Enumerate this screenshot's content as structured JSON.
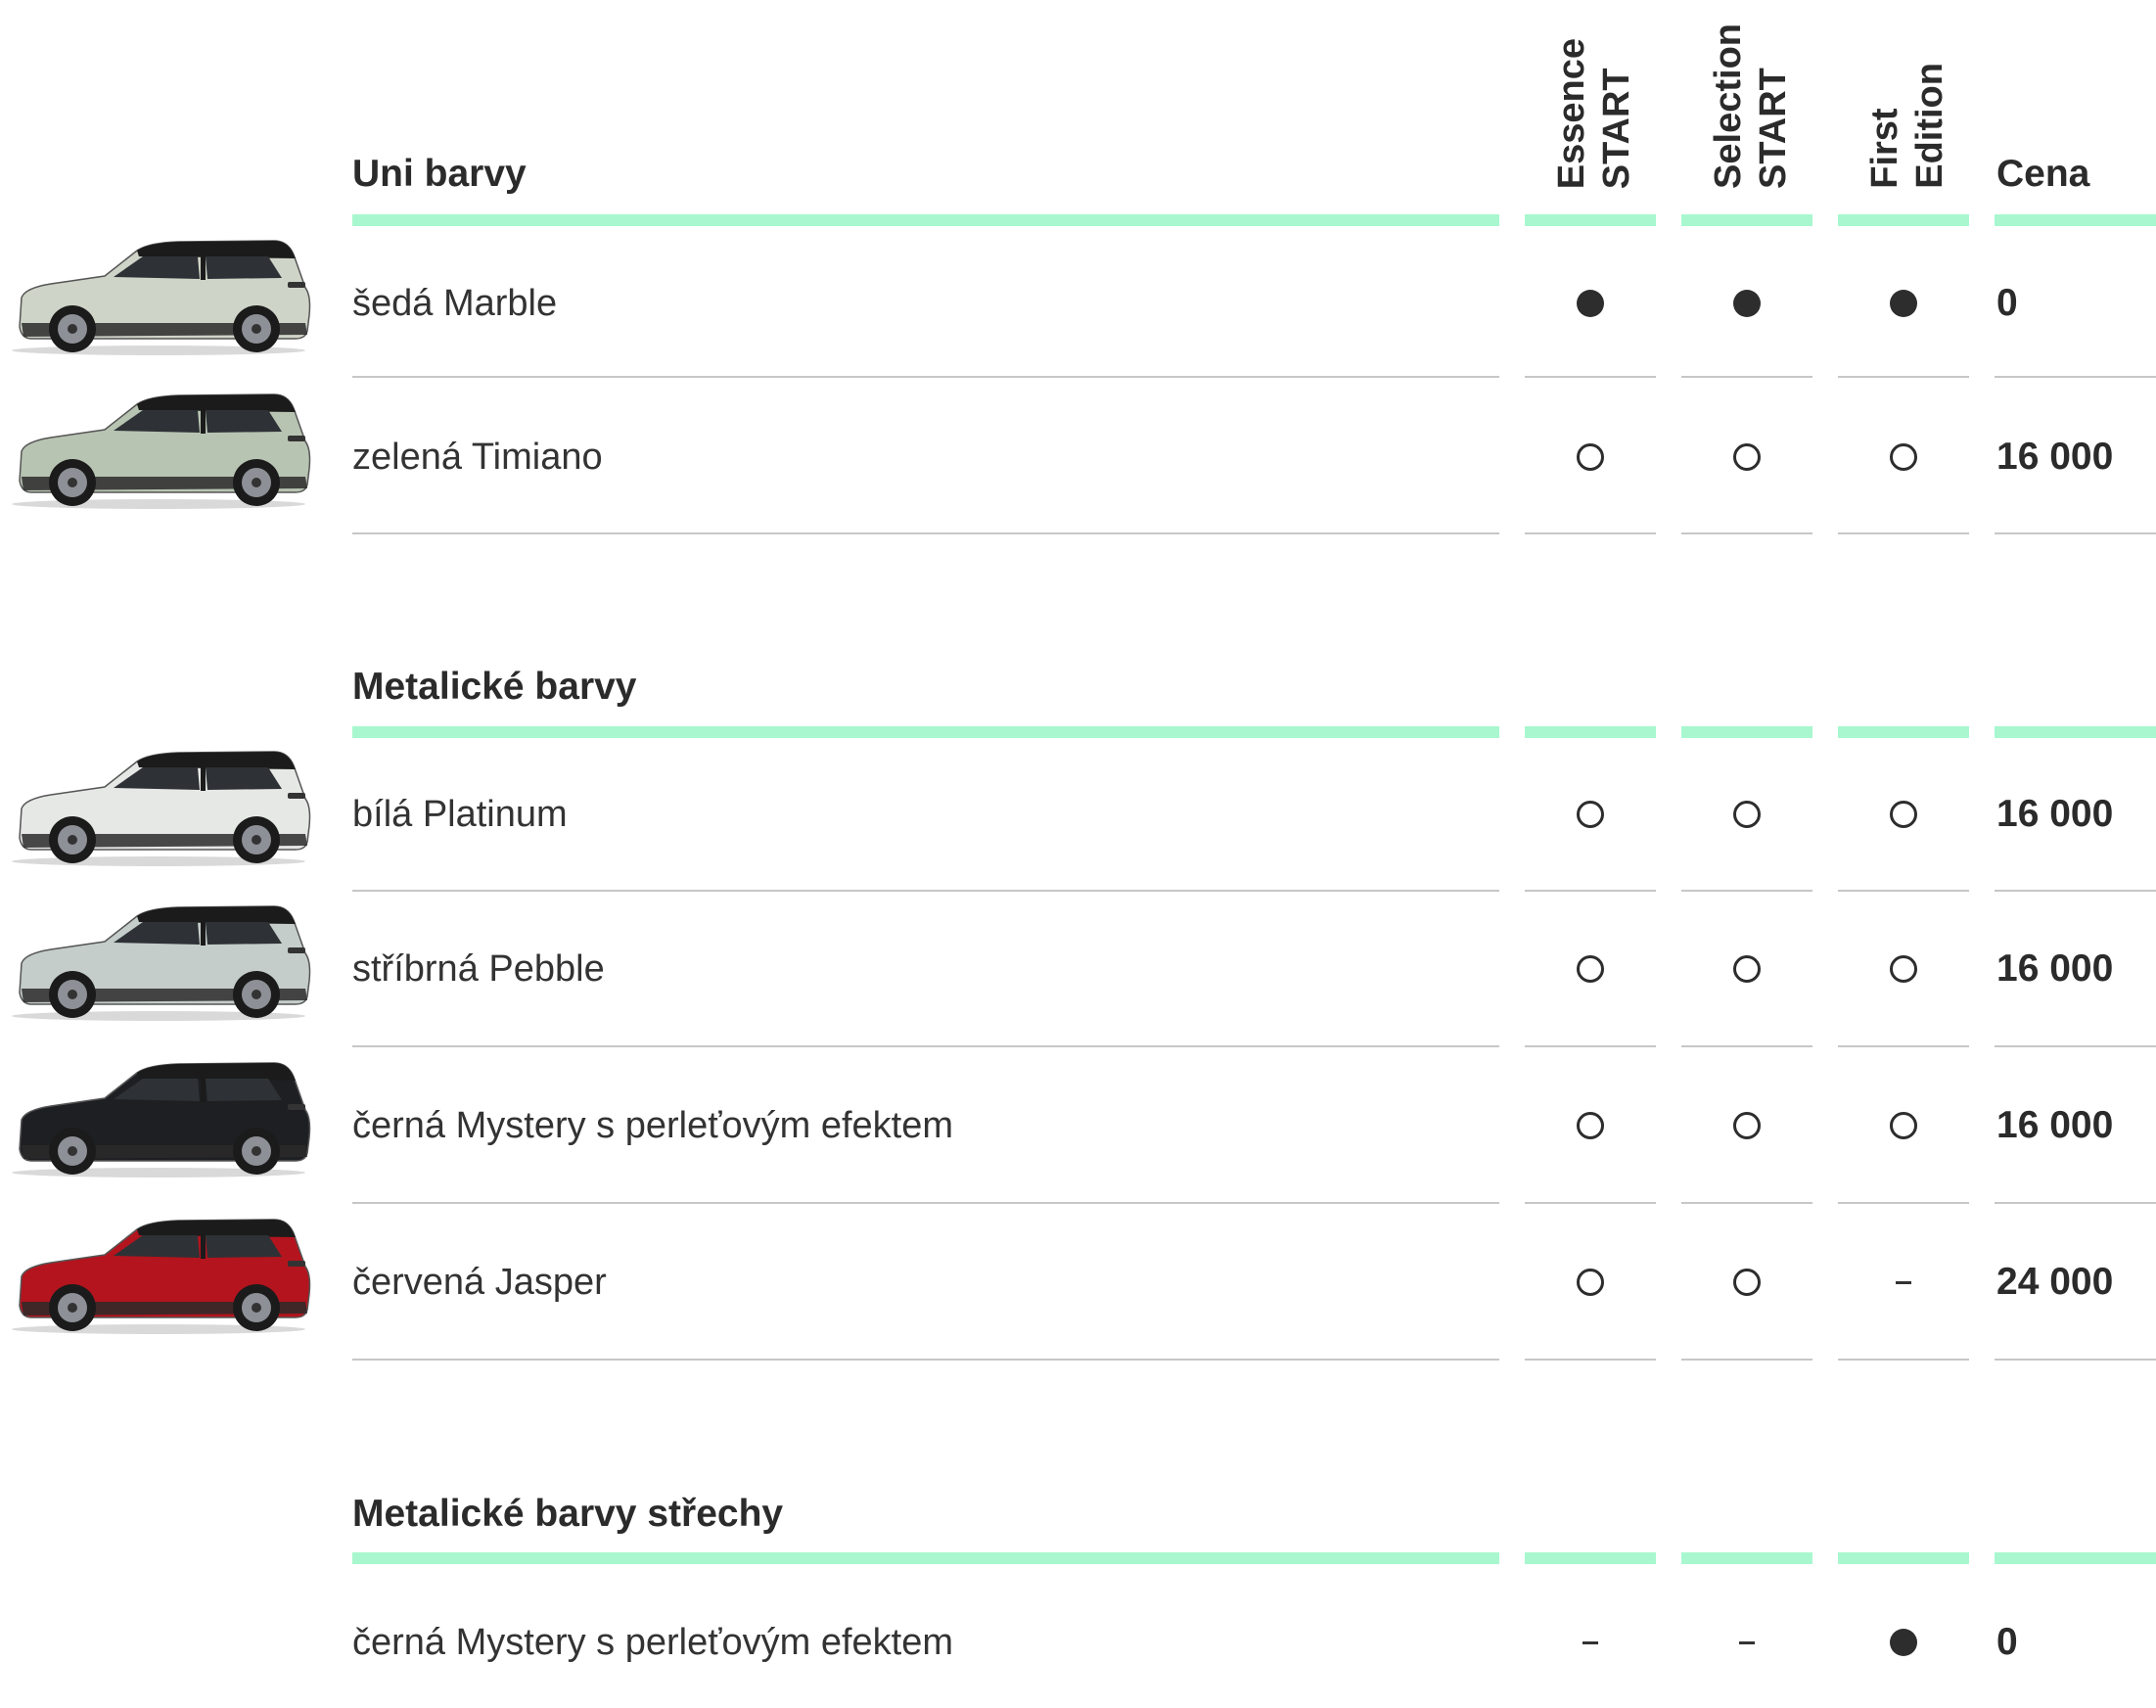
{
  "columns": {
    "essence": [
      "Essence",
      "START"
    ],
    "selection": [
      "Selection",
      "START"
    ],
    "first": [
      "First",
      "Edition"
    ],
    "price": "Cena"
  },
  "legend": {
    "standard": "●",
    "optional": "○",
    "not_available": "–"
  },
  "sections": [
    {
      "title": "Uni barvy",
      "rows": [
        {
          "label": "šedá Marble",
          "essence": "standard",
          "selection": "standard",
          "first": "standard",
          "price": "0",
          "car_color": "#cfd4c8"
        },
        {
          "label": "zelená Timiano",
          "essence": "optional",
          "selection": "optional",
          "first": "optional",
          "price": "16 000",
          "car_color": "#b8c4b2"
        }
      ]
    },
    {
      "title": "Metalické barvy",
      "rows": [
        {
          "label": "bílá Platinum",
          "essence": "optional",
          "selection": "optional",
          "first": "optional",
          "price": "16 000",
          "car_color": "#e6e8e6"
        },
        {
          "label": "stříbrná Pebble",
          "essence": "optional",
          "selection": "optional",
          "first": "optional",
          "price": "16 000",
          "car_color": "#c5cdcb"
        },
        {
          "label": "černá Mystery s perleťovým efektem",
          "essence": "optional",
          "selection": "optional",
          "first": "optional",
          "price": "16 000",
          "car_color": "#1e1f22"
        },
        {
          "label": "červená Jasper",
          "essence": "optional",
          "selection": "optional",
          "first": "not_available",
          "price": "24 000",
          "car_color": "#b3141d"
        }
      ]
    },
    {
      "title": "Metalické barvy střechy",
      "rows": [
        {
          "label": "černá Mystery s perleťovým efektem",
          "essence": "not_available",
          "selection": "not_available",
          "first": "standard",
          "price": "0"
        }
      ]
    }
  ],
  "colors": {
    "accent": "#a8f7cf",
    "rule": "#c7c7c7",
    "text": "#2b2b2b"
  }
}
